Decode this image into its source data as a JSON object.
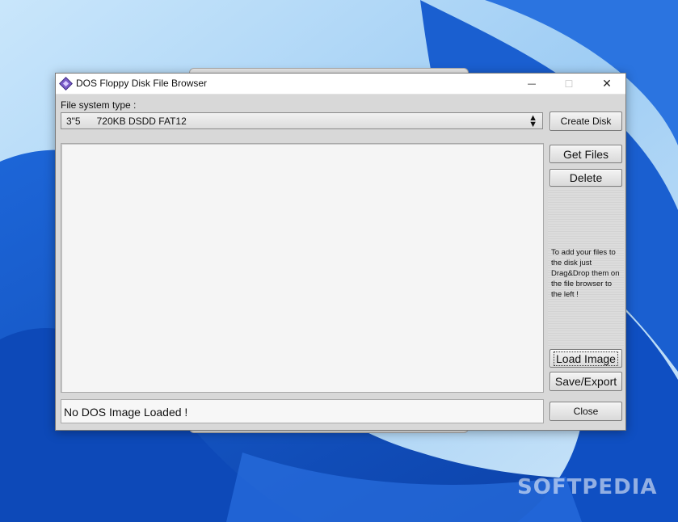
{
  "desktop": {
    "watermark": "SOFTPEDIA",
    "colors": {
      "wallpaper_dark": "#0b4fb0",
      "wallpaper_light": "#8fd0ff"
    }
  },
  "window": {
    "title": "DOS Floppy Disk File Browser",
    "icon": "floppy-diamond-icon",
    "controls": {
      "minimize": "—",
      "maximize": "☐",
      "close": "✕"
    }
  },
  "filesystem": {
    "label": "File system type :",
    "selected": "3\"5      720KB DSDD FAT12"
  },
  "buttons": {
    "create_disk": "Create Disk",
    "get_files": "Get Files",
    "delete": "Delete",
    "load_image": "Load Image",
    "save_export": "Save/Export",
    "close": "Close"
  },
  "hint": "To add your files to the disk just Drag&Drop them on the file browser to the left !",
  "status": "No DOS Image Loaded !"
}
